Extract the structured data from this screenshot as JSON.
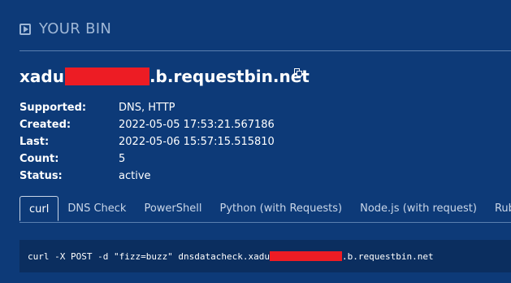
{
  "header": {
    "title": "YOUR BIN",
    "icon": "play-square-icon"
  },
  "bin": {
    "url_prefix": "xadu",
    "url_suffix": ".b.requestbin.net",
    "copy_icon": "copy-icon",
    "redaction_color": "#ed1c24"
  },
  "details": [
    {
      "key": "Supported:",
      "value": "DNS, HTTP"
    },
    {
      "key": "Created:",
      "value": "2022-05-05 17:53:21.567186"
    },
    {
      "key": "Last:",
      "value": "2022-05-06 15:57:15.515810"
    },
    {
      "key": "Count:",
      "value": "5"
    },
    {
      "key": "Status:",
      "value": "active"
    }
  ],
  "tabs": [
    {
      "label": "curl",
      "active": true
    },
    {
      "label": "DNS Check",
      "active": false
    },
    {
      "label": "PowerShell",
      "active": false
    },
    {
      "label": "Python (with Requests)",
      "active": false
    },
    {
      "label": "Node.js (with request)",
      "active": false
    },
    {
      "label": "Rub",
      "active": false
    }
  ],
  "code": {
    "prefix": "curl -X POST -d \"fizz=buzz\" dnsdatacheck.xadu",
    "suffix": ".b.requestbin.net"
  },
  "colors": {
    "background": "#0d3a78",
    "code_background": "#0b2e5f",
    "muted": "#9fb7d6"
  }
}
